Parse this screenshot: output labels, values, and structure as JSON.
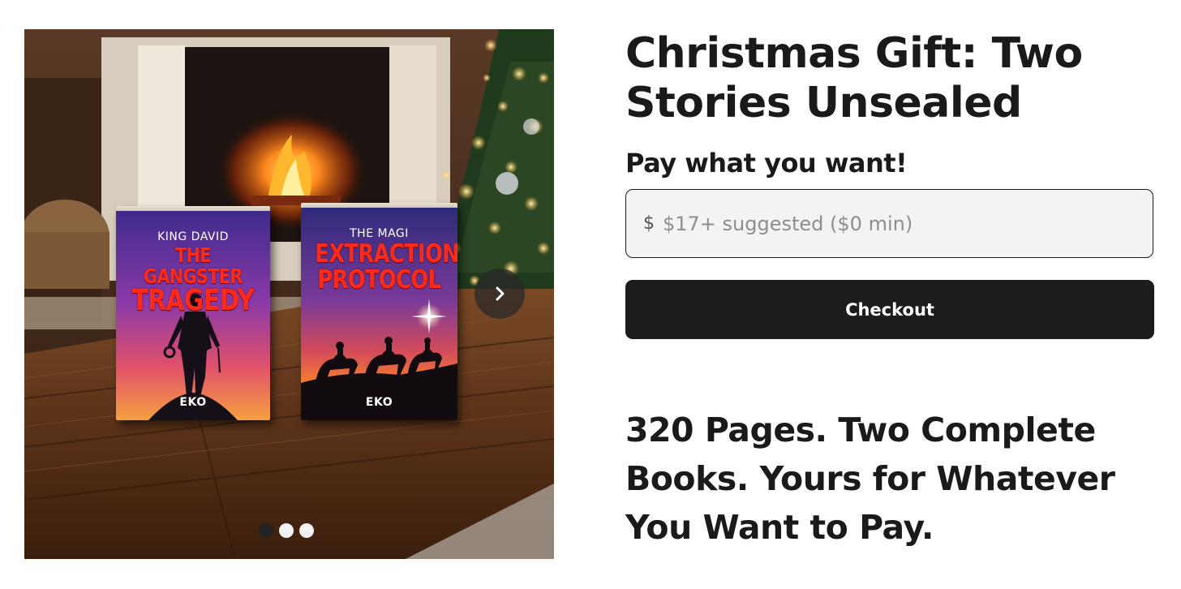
{
  "product": {
    "title": "Christmas Gift: Two Stories Unsealed",
    "price_label": "Pay what you want!",
    "currency_symbol": "$",
    "price_value": "",
    "price_placeholder": "$17+ suggested ($0 min)",
    "checkout_label": "Checkout",
    "tagline": "320 Pages. Two Complete Books. Yours for Whatever You Want to Pay."
  },
  "carousel": {
    "slide_count": 3,
    "active_slide": 1,
    "next_icon": "chevron-right-icon",
    "books": [
      {
        "subtitle": "KING DAVID",
        "title_line_1": "THE GANGSTER",
        "title_line_2": "TRAGEDY",
        "author": "EKO"
      },
      {
        "subtitle": "THE MAGI",
        "title_line_1": "EXTRACTION",
        "title_line_2": "PROTOCOL",
        "author": "EKO"
      }
    ]
  },
  "colors": {
    "text": "#1a1a1a",
    "button_bg": "#1c1c1c",
    "button_text": "#ffffff",
    "input_bg": "#f3f3f3",
    "book_title_red": "#ff2a1a"
  }
}
